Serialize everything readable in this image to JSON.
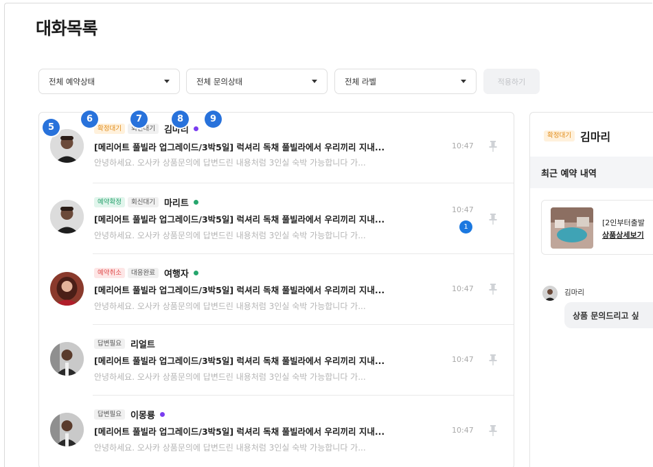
{
  "page": {
    "title": "대화목록"
  },
  "filters": {
    "reservation_status": "전체 예약상태",
    "inquiry_status": "전체 문의상태",
    "label": "전체 라벨",
    "apply_label": "적용하기"
  },
  "markers": [
    "5",
    "6",
    "7",
    "8",
    "9"
  ],
  "conversations": [
    {
      "tags": [
        {
          "text": "확정대기",
          "style": "orange"
        },
        {
          "text": "회신대기",
          "style": "gray"
        }
      ],
      "name": "김마리",
      "status_dot": "purple",
      "subject": "[메리어트 풀빌라 업그레이드/3박5일] 럭셔리 독채 풀빌라에서 우리끼리 지내...",
      "preview": "안녕하세요. 오사카 상품문의에 답변드린 내용처럼 3인실 숙박 가능합니다 가...",
      "time": "10:47",
      "unread": ""
    },
    {
      "tags": [
        {
          "text": "예약확정",
          "style": "green"
        },
        {
          "text": "회신대기",
          "style": "gray"
        }
      ],
      "name": "마리트",
      "status_dot": "green",
      "subject": "[메리어트 풀빌라 업그레이드/3박5일] 럭셔리 독채 풀빌라에서 우리끼리 지내...",
      "preview": "안녕하세요. 오사카 상품문의에 답변드린 내용처럼 3인실 숙박 가능합니다 가...",
      "time": "10:47",
      "unread": "1"
    },
    {
      "tags": [
        {
          "text": "예약취소",
          "style": "red"
        },
        {
          "text": "대응완료",
          "style": "gray"
        }
      ],
      "name": "여행자",
      "status_dot": "green",
      "subject": "[메리어트 풀빌라 업그레이드/3박5일] 럭셔리 독채 풀빌라에서 우리끼리 지내...",
      "preview": "안녕하세요. 오사카 상품문의에 답변드린 내용처럼 3인실 숙박 가능합니다 가...",
      "time": "10:47",
      "unread": ""
    },
    {
      "tags": [
        {
          "text": "답변필요",
          "style": "gray"
        }
      ],
      "name": "리얼트",
      "status_dot": "",
      "subject": "[메리어트 풀빌라 업그레이드/3박5일] 럭셔리 독채 풀빌라에서 우리끼리 지내...",
      "preview": "안녕하세요. 오사카 상품문의에 답변드린 내용처럼 3인실 숙박 가능합니다 가...",
      "time": "10:47",
      "unread": ""
    },
    {
      "tags": [
        {
          "text": "답변필요",
          "style": "gray"
        }
      ],
      "name": "이몽룡",
      "status_dot": "purple",
      "subject": "[메리어트 풀빌라 업그레이드/3박5일] 럭셔리 독채 풀빌라에서 우리끼리 지내...",
      "preview": "안녕하세요. 오사카 상품문의에 답변드린 내용처럼 3인실 숙박 가능합니다 가...",
      "time": "10:47",
      "unread": ""
    }
  ],
  "detail": {
    "tag": "확정대기",
    "name": "김마리",
    "section_title": "최근 예약 내역",
    "product_title": "[2인부터출발",
    "product_link": "상품상세보기",
    "chat_name": "김마리",
    "chat_message": "상품 문의드리고 싶"
  },
  "colors": {
    "accent": "#1b78e0",
    "marker": "#2872db",
    "online_green": "#26a66d",
    "dot_purple": "#7a3df0"
  },
  "icons": {
    "pin": "pin-icon",
    "dropdown": "caret-down-icon"
  }
}
